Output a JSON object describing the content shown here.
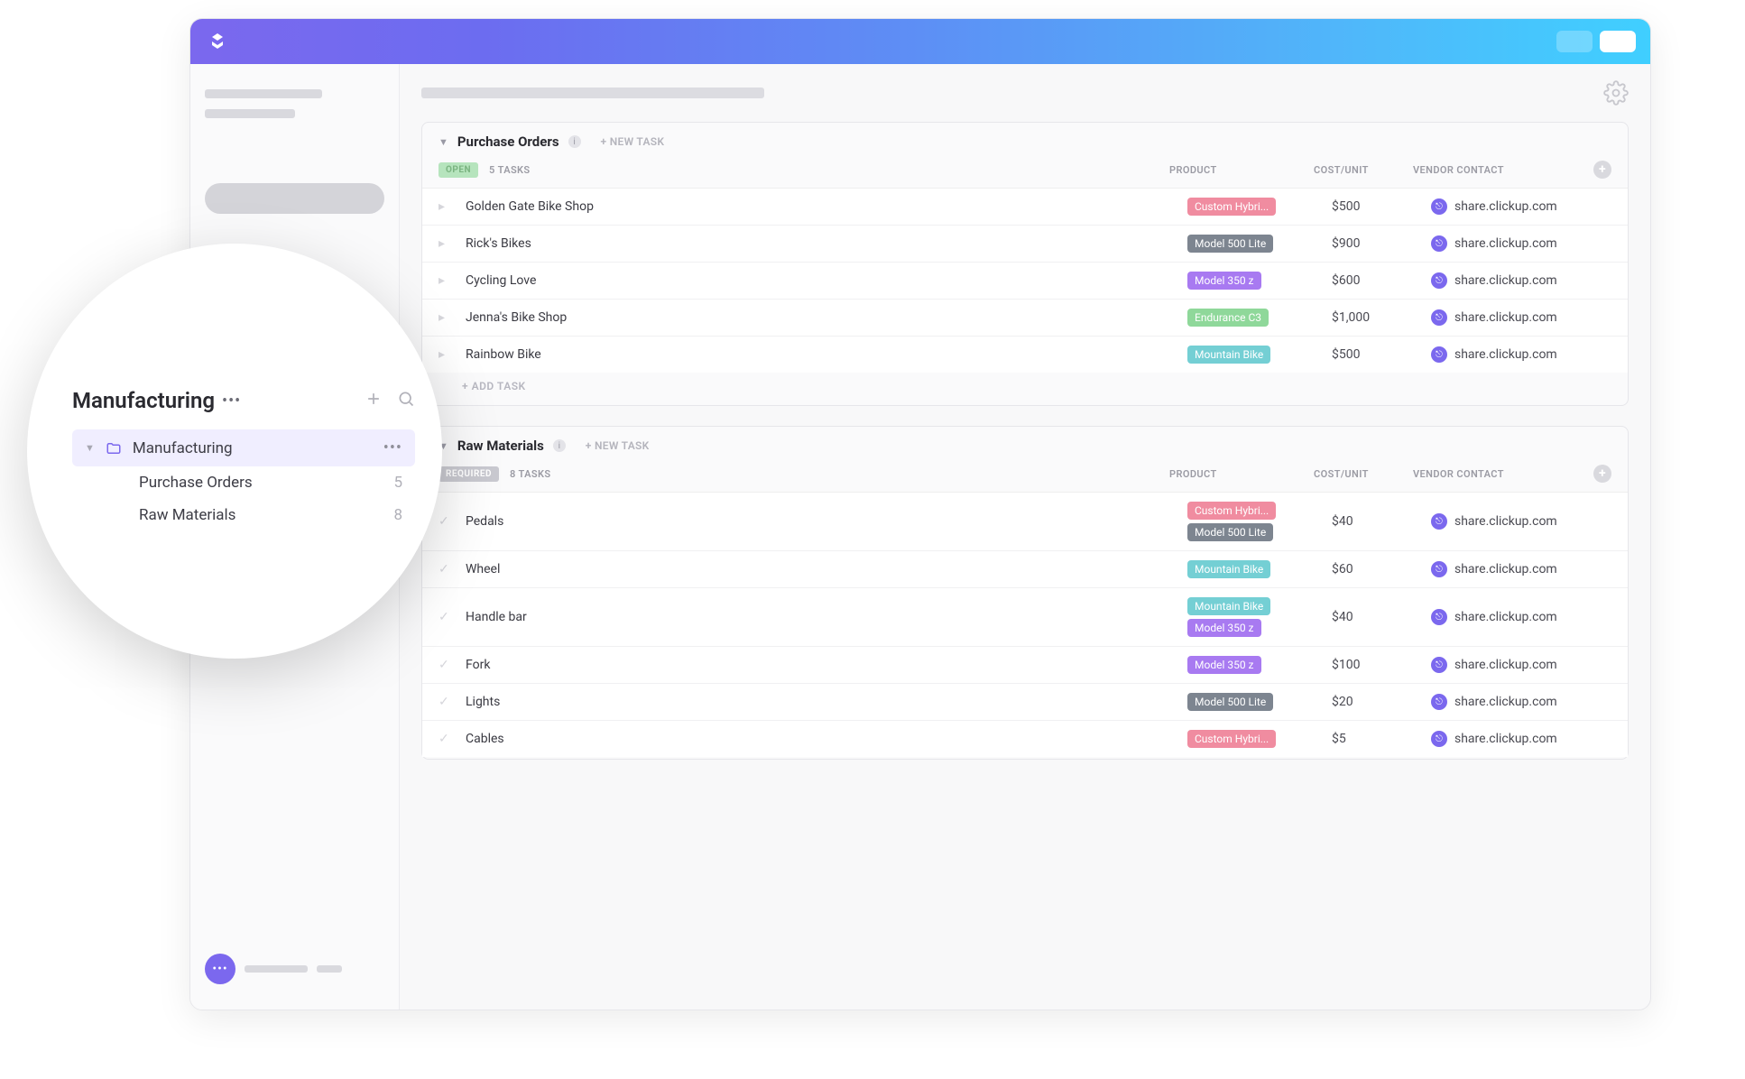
{
  "header": {
    "gear_tooltip": "Settings"
  },
  "columns": {
    "product": "PRODUCT",
    "cost": "COST/UNIT",
    "vendor": "VENDOR CONTACT"
  },
  "new_task_label": "+ NEW TASK",
  "add_task_label": "+ ADD TASK",
  "tag_colors": {
    "Custom Hybri...": "tag-pink",
    "Model 500 Lite": "tag-gray",
    "Model 350 z": "tag-purple",
    "Endurance C3": "tag-green",
    "Mountain Bike": "tag-teal"
  },
  "groups": [
    {
      "title": "Purchase Orders",
      "status_label": "OPEN",
      "status_class": "status-open",
      "count_label": "5 TASKS",
      "rows": [
        {
          "name": "Golden Gate Bike Shop",
          "products": [
            "Custom Hybri..."
          ],
          "cost": "$500",
          "vendor": "share.clickup.com"
        },
        {
          "name": "Rick's Bikes",
          "products": [
            "Model 500 Lite"
          ],
          "cost": "$900",
          "vendor": "share.clickup.com"
        },
        {
          "name": "Cycling Love",
          "products": [
            "Model 350 z"
          ],
          "cost": "$600",
          "vendor": "share.clickup.com"
        },
        {
          "name": "Jenna's Bike Shop",
          "products": [
            "Endurance C3"
          ],
          "cost": "$1,000",
          "vendor": "share.clickup.com"
        },
        {
          "name": "Rainbow Bike",
          "products": [
            "Mountain Bike"
          ],
          "cost": "$500",
          "vendor": "share.clickup.com"
        }
      ]
    },
    {
      "title": "Raw Materials",
      "status_label": "REQUIRED",
      "status_class": "status-open2",
      "count_label": "8 TASKS",
      "rows": [
        {
          "name": "Pedals",
          "products": [
            "Custom Hybri...",
            "Model 500 Lite"
          ],
          "cost": "$40",
          "vendor": "share.clickup.com"
        },
        {
          "name": "Wheel",
          "products": [
            "Mountain Bike"
          ],
          "cost": "$60",
          "vendor": "share.clickup.com"
        },
        {
          "name": "Handle bar",
          "products": [
            "Mountain Bike",
            "Model 350 z"
          ],
          "cost": "$40",
          "vendor": "share.clickup.com"
        },
        {
          "name": "Fork",
          "products": [
            "Model 350 z"
          ],
          "cost": "$100",
          "vendor": "share.clickup.com"
        },
        {
          "name": "Lights",
          "products": [
            "Model 500 Lite"
          ],
          "cost": "$20",
          "vendor": "share.clickup.com"
        },
        {
          "name": "Cables",
          "products": [
            "Custom Hybri..."
          ],
          "cost": "$5",
          "vendor": "share.clickup.com"
        }
      ]
    }
  ],
  "zoom": {
    "space_title": "Manufacturing",
    "items": [
      {
        "label": "Manufacturing",
        "active": true,
        "is_folder": true
      },
      {
        "label": "Purchase Orders",
        "count": "5"
      },
      {
        "label": "Raw Materials",
        "count": "8"
      }
    ]
  }
}
